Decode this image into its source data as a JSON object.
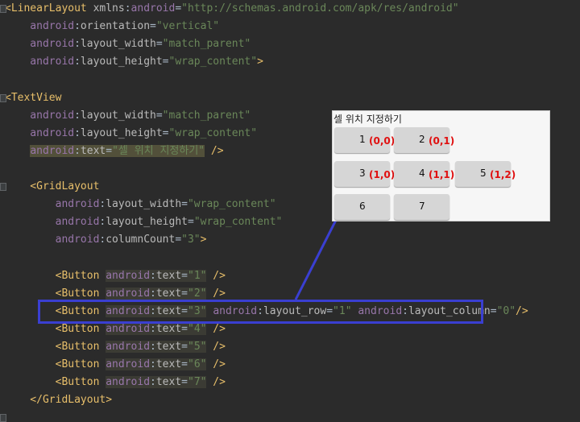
{
  "code_lines": [
    {
      "parts": [
        {
          "c": "tag",
          "t": "<LinearLayout "
        },
        {
          "c": "attr",
          "t": "xmlns"
        },
        {
          "c": "plain",
          "t": ":"
        },
        {
          "c": "attrns",
          "t": "android"
        },
        {
          "c": "plain",
          "t": "="
        },
        {
          "c": "str",
          "t": "\"http://schemas.android.com/apk/res/android\""
        }
      ]
    },
    {
      "parts": [
        {
          "c": "attrns",
          "t": "    android"
        },
        {
          "c": "plain",
          "t": ":"
        },
        {
          "c": "attr",
          "t": "orientation"
        },
        {
          "c": "plain",
          "t": "="
        },
        {
          "c": "str",
          "t": "\"vertical\""
        }
      ]
    },
    {
      "parts": [
        {
          "c": "attrns",
          "t": "    android"
        },
        {
          "c": "plain",
          "t": ":"
        },
        {
          "c": "attr",
          "t": "layout_width"
        },
        {
          "c": "plain",
          "t": "="
        },
        {
          "c": "str",
          "t": "\"match_parent\""
        }
      ]
    },
    {
      "parts": [
        {
          "c": "attrns",
          "t": "    android"
        },
        {
          "c": "plain",
          "t": ":"
        },
        {
          "c": "attr",
          "t": "layout_height"
        },
        {
          "c": "plain",
          "t": "="
        },
        {
          "c": "str",
          "t": "\"wrap_content\""
        },
        {
          "c": "tag",
          "t": ">"
        }
      ]
    },
    {
      "parts": []
    },
    {
      "parts": [
        {
          "c": "tag",
          "t": "<TextView"
        }
      ]
    },
    {
      "parts": [
        {
          "c": "attrns",
          "t": "    android"
        },
        {
          "c": "plain",
          "t": ":"
        },
        {
          "c": "attr",
          "t": "layout_width"
        },
        {
          "c": "plain",
          "t": "="
        },
        {
          "c": "str",
          "t": "\"match_parent\""
        }
      ]
    },
    {
      "parts": [
        {
          "c": "attrns",
          "t": "    android"
        },
        {
          "c": "plain",
          "t": ":"
        },
        {
          "c": "attr",
          "t": "layout_height"
        },
        {
          "c": "plain",
          "t": "="
        },
        {
          "c": "str",
          "t": "\"wrap_content\""
        }
      ]
    },
    {
      "parts": [
        {
          "c": "plain",
          "t": "    "
        },
        {
          "c": "attrns hl",
          "t": "android"
        },
        {
          "c": "plain hl",
          "t": ":"
        },
        {
          "c": "attr hl",
          "t": "text"
        },
        {
          "c": "plain hl",
          "t": "="
        },
        {
          "c": "str hl",
          "t": "\"셀 위치 지정하기\""
        },
        {
          "c": "tag",
          "t": " />"
        }
      ]
    },
    {
      "parts": []
    },
    {
      "parts": [
        {
          "c": "tag",
          "t": "    <GridLayout"
        }
      ]
    },
    {
      "parts": [
        {
          "c": "attrns",
          "t": "        android"
        },
        {
          "c": "plain",
          "t": ":"
        },
        {
          "c": "attr",
          "t": "layout_width"
        },
        {
          "c": "plain",
          "t": "="
        },
        {
          "c": "str",
          "t": "\"wrap_content\""
        }
      ]
    },
    {
      "parts": [
        {
          "c": "attrns",
          "t": "        android"
        },
        {
          "c": "plain",
          "t": ":"
        },
        {
          "c": "attr",
          "t": "layout_height"
        },
        {
          "c": "plain",
          "t": "="
        },
        {
          "c": "str",
          "t": "\"wrap_content\""
        }
      ]
    },
    {
      "parts": [
        {
          "c": "attrns",
          "t": "        android"
        },
        {
          "c": "plain",
          "t": ":"
        },
        {
          "c": "attr",
          "t": "columnCount"
        },
        {
          "c": "plain",
          "t": "="
        },
        {
          "c": "str",
          "t": "\"3\""
        },
        {
          "c": "tag",
          "t": ">"
        }
      ]
    },
    {
      "parts": []
    },
    {
      "parts": [
        {
          "c": "tag",
          "t": "        <Button "
        },
        {
          "c": "attrns hl2",
          "t": "android"
        },
        {
          "c": "plain hl2",
          "t": ":"
        },
        {
          "c": "attr hl2",
          "t": "text"
        },
        {
          "c": "plain hl2",
          "t": "="
        },
        {
          "c": "str hl2",
          "t": "\"1\""
        },
        {
          "c": "tag",
          "t": " />"
        }
      ]
    },
    {
      "parts": [
        {
          "c": "tag",
          "t": "        <Button "
        },
        {
          "c": "attrns hl2",
          "t": "android"
        },
        {
          "c": "plain hl2",
          "t": ":"
        },
        {
          "c": "attr hl2",
          "t": "text"
        },
        {
          "c": "plain hl2",
          "t": "="
        },
        {
          "c": "str hl2",
          "t": "\"2\""
        },
        {
          "c": "tag",
          "t": " />"
        }
      ]
    },
    {
      "parts": [
        {
          "c": "tag",
          "t": "        <Button "
        },
        {
          "c": "attrns hl2",
          "t": "android"
        },
        {
          "c": "plain hl2",
          "t": ":"
        },
        {
          "c": "attr hl2",
          "t": "text"
        },
        {
          "c": "plain hl2",
          "t": "="
        },
        {
          "c": "str hl2",
          "t": "\"3\""
        },
        {
          "c": "plain",
          "t": " "
        },
        {
          "c": "attrns",
          "t": "android"
        },
        {
          "c": "plain",
          "t": ":"
        },
        {
          "c": "attr",
          "t": "layout_row"
        },
        {
          "c": "plain",
          "t": "="
        },
        {
          "c": "str",
          "t": "\"1\""
        },
        {
          "c": "plain",
          "t": " "
        },
        {
          "c": "attrns",
          "t": "android"
        },
        {
          "c": "plain",
          "t": ":"
        },
        {
          "c": "attr",
          "t": "layout_column"
        },
        {
          "c": "plain",
          "t": "="
        },
        {
          "c": "str",
          "t": "\"0\""
        },
        {
          "c": "tag",
          "t": "/>"
        }
      ]
    },
    {
      "parts": [
        {
          "c": "tag",
          "t": "        <Button "
        },
        {
          "c": "attrns hl2",
          "t": "android"
        },
        {
          "c": "plain hl2",
          "t": ":"
        },
        {
          "c": "attr hl2",
          "t": "text"
        },
        {
          "c": "plain hl2",
          "t": "="
        },
        {
          "c": "str hl2",
          "t": "\"4\""
        },
        {
          "c": "tag",
          "t": " />"
        }
      ]
    },
    {
      "parts": [
        {
          "c": "tag",
          "t": "        <Button "
        },
        {
          "c": "attrns hl2",
          "t": "android"
        },
        {
          "c": "plain hl2",
          "t": ":"
        },
        {
          "c": "attr hl2",
          "t": "text"
        },
        {
          "c": "plain hl2",
          "t": "="
        },
        {
          "c": "str hl2",
          "t": "\"5\""
        },
        {
          "c": "tag",
          "t": " />"
        }
      ]
    },
    {
      "parts": [
        {
          "c": "tag",
          "t": "        <Button "
        },
        {
          "c": "attrns hl2",
          "t": "android"
        },
        {
          "c": "plain hl2",
          "t": ":"
        },
        {
          "c": "attr hl2",
          "t": "text"
        },
        {
          "c": "plain hl2",
          "t": "="
        },
        {
          "c": "str hl2",
          "t": "\"6\""
        },
        {
          "c": "tag",
          "t": " />"
        }
      ]
    },
    {
      "parts": [
        {
          "c": "tag",
          "t": "        <Button "
        },
        {
          "c": "attrns hl2",
          "t": "android"
        },
        {
          "c": "plain hl2",
          "t": ":"
        },
        {
          "c": "attr hl2",
          "t": "text"
        },
        {
          "c": "plain hl2",
          "t": "="
        },
        {
          "c": "str hl2",
          "t": "\"7\""
        },
        {
          "c": "tag",
          "t": " />"
        }
      ]
    },
    {
      "parts": [
        {
          "c": "tag",
          "t": "    </GridLayout>"
        }
      ]
    }
  ],
  "preview": {
    "title": "셀 위치 지정하기",
    "buttons": [
      {
        "label": "1",
        "coord": "(0,0)"
      },
      {
        "label": "2",
        "coord": "(0,1)"
      },
      {
        "label": "3",
        "coord": "(1,0)"
      },
      {
        "label": "4",
        "coord": "(1,1)"
      },
      {
        "label": "5",
        "coord": "(1,2)"
      },
      {
        "label": "6",
        "coord": ""
      },
      {
        "label": "7",
        "coord": ""
      }
    ]
  },
  "colors": {
    "highlight_box": "#3a3fd1",
    "coord_text": "#e01010",
    "editor_bg": "#2b2b2b"
  }
}
